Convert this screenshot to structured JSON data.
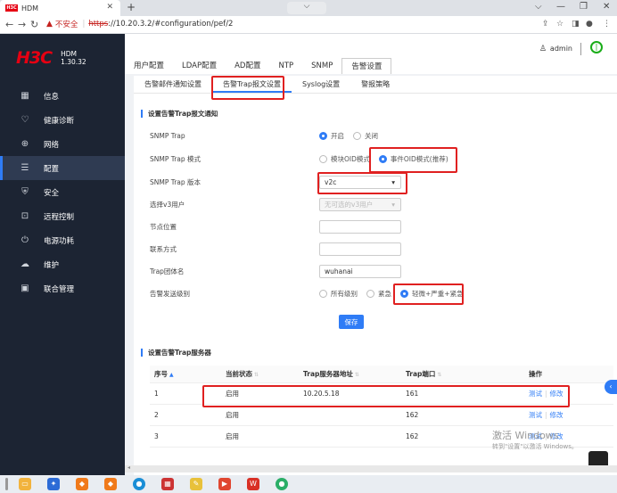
{
  "browser": {
    "tab_title": "HDM",
    "tab_favicon_text": "H3C",
    "address": {
      "warning_label": "不安全",
      "scheme": "https",
      "rest": "://10.20.3.2/#configuration/pef/2"
    }
  },
  "sidebar": {
    "logo": "H3C",
    "product": "HDM",
    "version": "1.30.32",
    "items": [
      {
        "label": "信息",
        "icon": "grid-icon",
        "glyph": "▦"
      },
      {
        "label": "健康诊断",
        "icon": "health-icon",
        "glyph": "♡"
      },
      {
        "label": "网络",
        "icon": "globe-icon",
        "glyph": "⊕"
      },
      {
        "label": "配置",
        "icon": "sliders-icon",
        "glyph": "☰"
      },
      {
        "label": "安全",
        "icon": "shield-icon",
        "glyph": "⛨"
      },
      {
        "label": "远程控制",
        "icon": "remote-icon",
        "glyph": "⊡"
      },
      {
        "label": "电源功耗",
        "icon": "power-icon",
        "glyph": "⏻"
      },
      {
        "label": "维护",
        "icon": "cloud-icon",
        "glyph": "☁"
      },
      {
        "label": "联合管理",
        "icon": "device-icon",
        "glyph": "▣"
      }
    ],
    "active_index": 3
  },
  "header": {
    "user": "admin",
    "top_tabs": [
      "用户配置",
      "LDAP配置",
      "AD配置",
      "NTP",
      "SNMP",
      "告警设置"
    ],
    "active_top_tab": 5
  },
  "subtabs": [
    "告警邮件通知设置",
    "告警Trap报文设置",
    "Syslog设置",
    "警报策略"
  ],
  "active_subtab": 1,
  "trap_section": {
    "title": "设置告警Trap报文通知",
    "snmp_trap_label": "SNMP Trap",
    "snmp_trap_on": "开启",
    "snmp_trap_off": "关闭",
    "mode_label": "SNMP Trap 模式",
    "mode_module": "模块OID模式",
    "mode_event": "事件OID模式(推荐)",
    "version_label": "SNMP Trap 版本",
    "version_value": "v2c",
    "v3user_label": "选择v3用户",
    "v3user_placeholder": "无可选的v3用户",
    "location_label": "节点位置",
    "location_value": "",
    "contact_label": "联系方式",
    "contact_value": "",
    "community_label": "Trap团体名",
    "community_value": "wuhanai",
    "level_label": "告警发送级别",
    "level_all": "所有级别",
    "level_urgent": "紧急",
    "level_selected": "轻微+严重+紧急",
    "save_label": "保存"
  },
  "server_section": {
    "title": "设置告警Trap服务器",
    "columns": [
      "序号",
      "当前状态",
      "Trap服务器地址",
      "Trap端口",
      "操作"
    ],
    "rows": [
      {
        "index": "1",
        "status": "启用",
        "address": "10.20.5.18",
        "port": "161",
        "test": "测试",
        "edit": "修改"
      },
      {
        "index": "2",
        "status": "启用",
        "address": "",
        "port": "162",
        "test": "测试",
        "edit": "修改"
      },
      {
        "index": "3",
        "status": "启用",
        "address": "",
        "port": "162",
        "test": "测试",
        "edit": "修改"
      }
    ]
  },
  "watermark": {
    "line1": "激活 Windows",
    "line2": "转到\"设置\"以激活 Windows。"
  },
  "colors": {
    "accent": "#2f7cf6",
    "brand": "#e60012",
    "highlight": "#e02020",
    "sidebar_bg": "#1c2433"
  }
}
